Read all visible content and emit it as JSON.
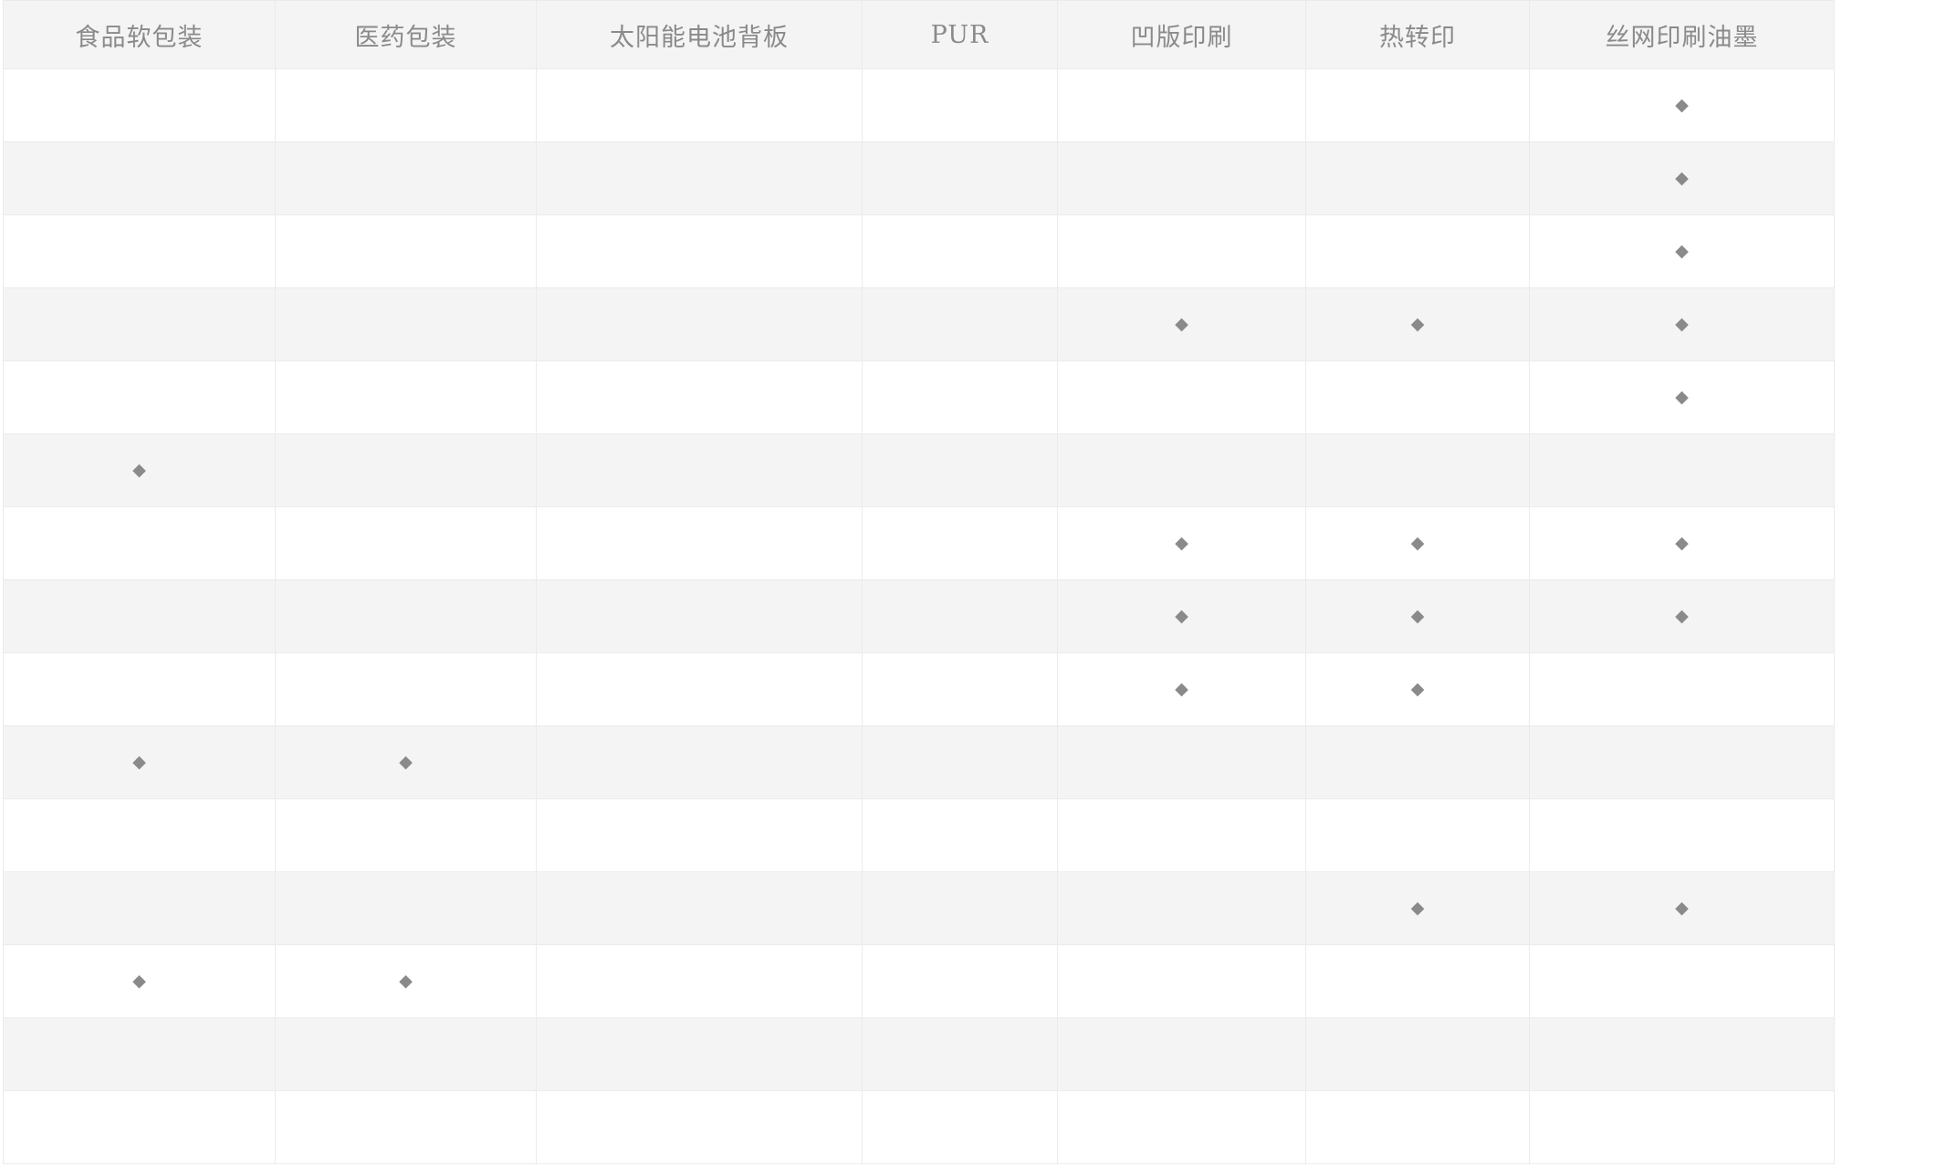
{
  "columns": [
    "食品软包装",
    "医药包装",
    "太阳能电池背板",
    "PUR",
    "凹版印刷",
    "热转印",
    "丝网印刷油墨"
  ],
  "mark_symbol": "◆",
  "mark_color": "#8a8a8a",
  "rows": [
    [
      false,
      false,
      false,
      false,
      false,
      false,
      true
    ],
    [
      false,
      false,
      false,
      false,
      false,
      false,
      true
    ],
    [
      false,
      false,
      false,
      false,
      false,
      false,
      true
    ],
    [
      false,
      false,
      false,
      false,
      true,
      true,
      true
    ],
    [
      false,
      false,
      false,
      false,
      false,
      false,
      true
    ],
    [
      true,
      false,
      false,
      false,
      false,
      false,
      false
    ],
    [
      false,
      false,
      false,
      false,
      true,
      true,
      true
    ],
    [
      false,
      false,
      false,
      false,
      true,
      true,
      true
    ],
    [
      false,
      false,
      false,
      false,
      true,
      true,
      false
    ],
    [
      true,
      true,
      false,
      false,
      false,
      false,
      false
    ],
    [
      false,
      false,
      false,
      false,
      false,
      false,
      false
    ],
    [
      false,
      false,
      false,
      false,
      false,
      true,
      true
    ],
    [
      true,
      true,
      false,
      false,
      false,
      false,
      false
    ],
    [
      false,
      false,
      false,
      false,
      false,
      false,
      false
    ],
    [
      false,
      false,
      false,
      false,
      false,
      false,
      false
    ]
  ]
}
